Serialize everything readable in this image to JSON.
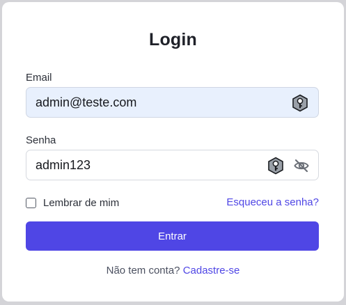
{
  "form": {
    "title": "Login",
    "email": {
      "label": "Email",
      "value": "admin@teste.com"
    },
    "password": {
      "label": "Senha",
      "value": "admin123"
    },
    "remember": {
      "label": "Lembrar de mim",
      "checked": false
    },
    "forgot_link": "Esqueceu a senha?",
    "submit_label": "Entrar",
    "signup_prompt": "Não tem conta?",
    "signup_link": "Cadastre-se"
  },
  "icons": {
    "password_manager": "key-hexagon-icon",
    "toggle_visibility": "eye-slash-icon"
  },
  "colors": {
    "accent": "#4f46e5",
    "autofill_background": "#e8f0fd"
  }
}
